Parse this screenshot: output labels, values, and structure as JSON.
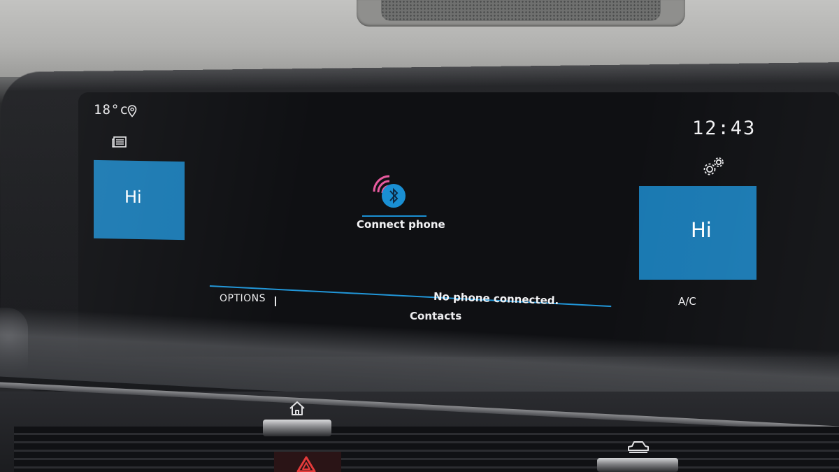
{
  "status": {
    "temperature": "18°c",
    "clock": "12:43"
  },
  "tiles": {
    "left_label": "Hi",
    "right_label": "Hi"
  },
  "climate": {
    "ac_label": "A/C"
  },
  "phone": {
    "connect_label": "Connect phone",
    "status_message": "No phone connected."
  },
  "bottom_bar": {
    "options_label": "OPTIONS",
    "contacts_label": "Contacts"
  },
  "icons": {
    "location": "location-pin-icon",
    "news": "news-icon",
    "settings": "gear-icon",
    "bluetooth": "bluetooth-icon",
    "home": "home-icon",
    "vehicle": "car-icon",
    "hazard": "hazard-icon"
  },
  "colors": {
    "tile_blue": "#1a79b2",
    "accent_blue": "#2196d8",
    "signal_pink": "#e75a9e",
    "screen_bg": "#0f1013"
  }
}
